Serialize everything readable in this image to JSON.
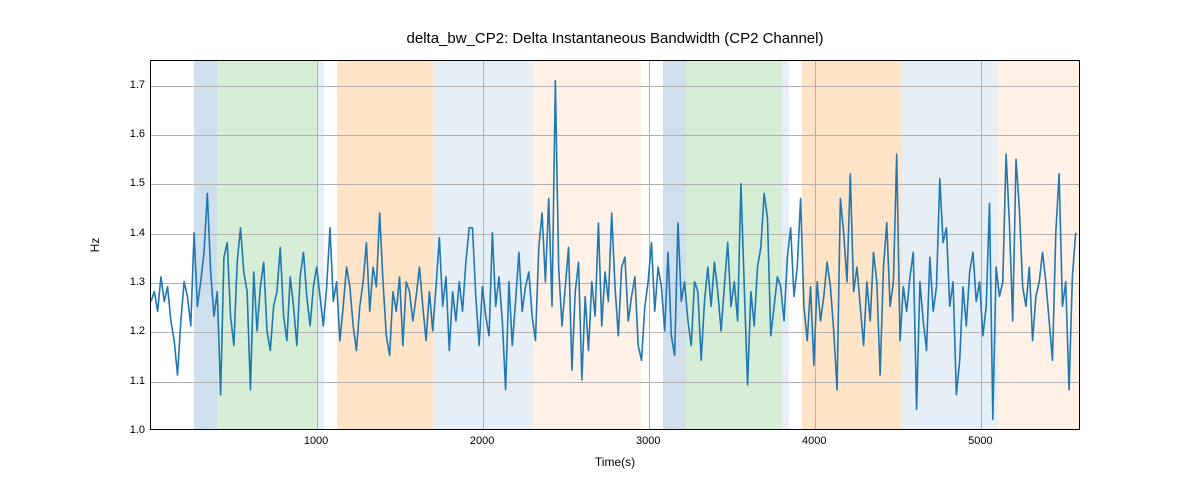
{
  "chart_data": {
    "type": "line",
    "title": "delta_bw_CP2: Delta Instantaneous Bandwidth (CP2 Channel)",
    "xlabel": "Time(s)",
    "ylabel": "Hz",
    "xlim": [
      0,
      5600
    ],
    "ylim": [
      1.0,
      1.75
    ],
    "xticks": [
      1000,
      2000,
      3000,
      4000,
      5000
    ],
    "yticks": [
      1.0,
      1.1,
      1.2,
      1.3,
      1.4,
      1.5,
      1.6,
      1.7
    ],
    "bands": [
      {
        "start": 260,
        "end": 400,
        "color": "blue"
      },
      {
        "start": 400,
        "end": 1000,
        "color": "green"
      },
      {
        "start": 1000,
        "end": 1040,
        "color": "lightblue"
      },
      {
        "start": 1120,
        "end": 1700,
        "color": "orange"
      },
      {
        "start": 1700,
        "end": 2300,
        "color": "lightblue"
      },
      {
        "start": 2300,
        "end": 2950,
        "color": "paleorange"
      },
      {
        "start": 3080,
        "end": 3220,
        "color": "blue"
      },
      {
        "start": 3220,
        "end": 3800,
        "color": "green"
      },
      {
        "start": 3800,
        "end": 3840,
        "color": "lightblue"
      },
      {
        "start": 3920,
        "end": 4520,
        "color": "orange"
      },
      {
        "start": 4520,
        "end": 5100,
        "color": "lightblue"
      },
      {
        "start": 5100,
        "end": 5600,
        "color": "paleorange"
      }
    ],
    "series": [
      {
        "name": "delta_bw_CP2",
        "x_start": 0,
        "x_step": 20,
        "values": [
          1.26,
          1.28,
          1.24,
          1.31,
          1.26,
          1.29,
          1.22,
          1.18,
          1.11,
          1.22,
          1.3,
          1.27,
          1.21,
          1.4,
          1.25,
          1.3,
          1.36,
          1.48,
          1.32,
          1.23,
          1.28,
          1.07,
          1.35,
          1.38,
          1.23,
          1.17,
          1.34,
          1.41,
          1.32,
          1.28,
          1.08,
          1.32,
          1.2,
          1.29,
          1.34,
          1.2,
          1.16,
          1.25,
          1.28,
          1.37,
          1.23,
          1.18,
          1.31,
          1.25,
          1.17,
          1.31,
          1.36,
          1.27,
          1.21,
          1.29,
          1.33,
          1.27,
          1.21,
          1.29,
          1.41,
          1.26,
          1.3,
          1.18,
          1.25,
          1.33,
          1.29,
          1.21,
          1.16,
          1.25,
          1.3,
          1.38,
          1.24,
          1.33,
          1.29,
          1.44,
          1.3,
          1.19,
          1.15,
          1.28,
          1.24,
          1.31,
          1.17,
          1.3,
          1.28,
          1.22,
          1.27,
          1.33,
          1.25,
          1.18,
          1.28,
          1.2,
          1.29,
          1.39,
          1.25,
          1.31,
          1.16,
          1.28,
          1.22,
          1.3,
          1.24,
          1.34,
          1.41,
          1.41,
          1.27,
          1.17,
          1.29,
          1.23,
          1.19,
          1.4,
          1.25,
          1.31,
          1.22,
          1.08,
          1.3,
          1.17,
          1.26,
          1.36,
          1.24,
          1.29,
          1.32,
          1.23,
          1.18,
          1.37,
          1.44,
          1.3,
          1.47,
          1.25,
          1.71,
          1.33,
          1.21,
          1.29,
          1.37,
          1.12,
          1.28,
          1.34,
          1.1,
          1.27,
          1.16,
          1.3,
          1.23,
          1.42,
          1.21,
          1.32,
          1.26,
          1.44,
          1.29,
          1.19,
          1.33,
          1.35,
          1.22,
          1.27,
          1.31,
          1.17,
          1.14,
          1.25,
          1.3,
          1.38,
          1.24,
          1.33,
          1.29,
          1.2,
          1.36,
          1.19,
          1.15,
          1.42,
          1.26,
          1.3,
          1.22,
          1.17,
          1.3,
          1.28,
          1.14,
          1.26,
          1.33,
          1.25,
          1.34,
          1.28,
          1.2,
          1.29,
          1.38,
          1.25,
          1.3,
          1.22,
          1.5,
          1.29,
          1.09,
          1.28,
          1.21,
          1.33,
          1.37,
          1.48,
          1.43,
          1.19,
          1.25,
          1.31,
          1.29,
          1.22,
          1.35,
          1.41,
          1.27,
          1.33,
          1.47,
          1.25,
          1.18,
          1.29,
          1.13,
          1.3,
          1.22,
          1.27,
          1.34,
          1.29,
          1.2,
          1.08,
          1.47,
          1.4,
          1.3,
          1.52,
          1.28,
          1.33,
          1.25,
          1.17,
          1.3,
          1.22,
          1.36,
          1.3,
          1.11,
          1.33,
          1.42,
          1.25,
          1.3,
          1.56,
          1.18,
          1.29,
          1.24,
          1.31,
          1.36,
          1.04,
          1.3,
          1.22,
          1.16,
          1.35,
          1.24,
          1.29,
          1.51,
          1.38,
          1.41,
          1.25,
          1.3,
          1.07,
          1.14,
          1.29,
          1.21,
          1.32,
          1.36,
          1.26,
          1.3,
          1.19,
          1.25,
          1.46,
          1.02,
          1.33,
          1.27,
          1.3,
          1.56,
          1.42,
          1.22,
          1.55,
          1.45,
          1.29,
          1.25,
          1.33,
          1.18,
          1.27,
          1.3,
          1.36,
          1.3,
          1.22,
          1.14,
          1.4,
          1.52,
          1.25,
          1.3,
          1.08,
          1.31,
          1.4
        ]
      }
    ]
  }
}
